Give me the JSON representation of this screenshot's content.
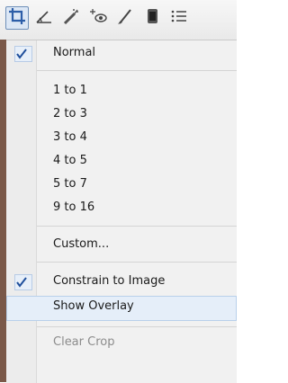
{
  "toolbar": {
    "tools": [
      {
        "icon": "crop-icon",
        "active": true
      },
      {
        "icon": "straighten-icon",
        "active": false
      },
      {
        "icon": "retouch-icon",
        "active": false
      },
      {
        "icon": "red-eye-icon",
        "active": false
      },
      {
        "icon": "brush-icon",
        "active": false
      },
      {
        "icon": "graduated-filter-icon",
        "active": false
      },
      {
        "icon": "menu-list-icon",
        "active": false
      }
    ]
  },
  "menu": {
    "items": [
      {
        "label": "Normal",
        "checked": true
      },
      {
        "label": "1 to 1"
      },
      {
        "label": "2 to 3"
      },
      {
        "label": "3 to 4"
      },
      {
        "label": "4 to 5"
      },
      {
        "label": "5 to 7"
      },
      {
        "label": "9 to 16"
      },
      {
        "label": "Custom..."
      },
      {
        "label": "Constrain to Image",
        "checked": true
      },
      {
        "label": "Show Overlay",
        "highlighted": true
      },
      {
        "label": "Clear Crop",
        "disabled": true
      }
    ]
  },
  "colors": {
    "accent": "#2d5ea8",
    "check": "#1f4f9c"
  }
}
